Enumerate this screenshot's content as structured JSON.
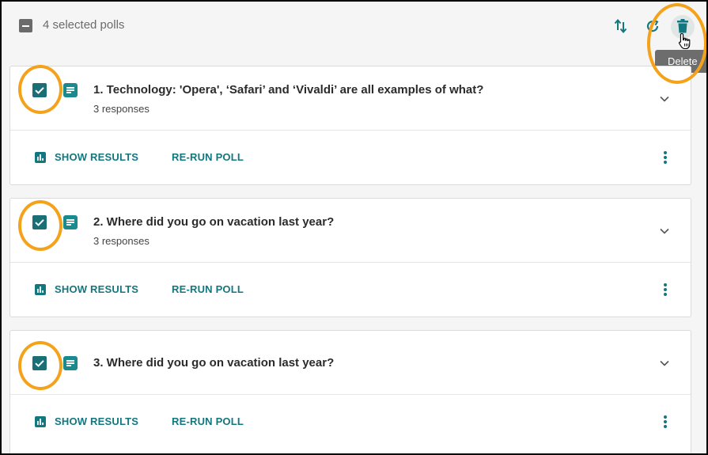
{
  "header": {
    "selected_label": "4 selected polls",
    "tooltip": "Delete",
    "icons": [
      "sort-icon",
      "refresh-icon",
      "trash-icon",
      "pointer-cursor-icon"
    ]
  },
  "polls": [
    {
      "title": "1. Technology: 'Opera', ‘Safari’ and ‘Vivaldi’ are all examples of what?",
      "responses": "3 responses",
      "checked": true
    },
    {
      "title": "2. Where did you go on vacation last year?",
      "responses": "3 responses",
      "checked": true
    },
    {
      "title": "3. Where did you go on vacation last year?",
      "responses": "",
      "checked": true
    }
  ],
  "actions": {
    "show_results": "SHOW RESULTS",
    "rerun": "RE-RUN POLL"
  },
  "colors": {
    "accent": "#12777f",
    "checkbox": "#1a6f76",
    "highlight_ring": "#f5a21b",
    "tooltip_bg": "#6d6d6d"
  }
}
